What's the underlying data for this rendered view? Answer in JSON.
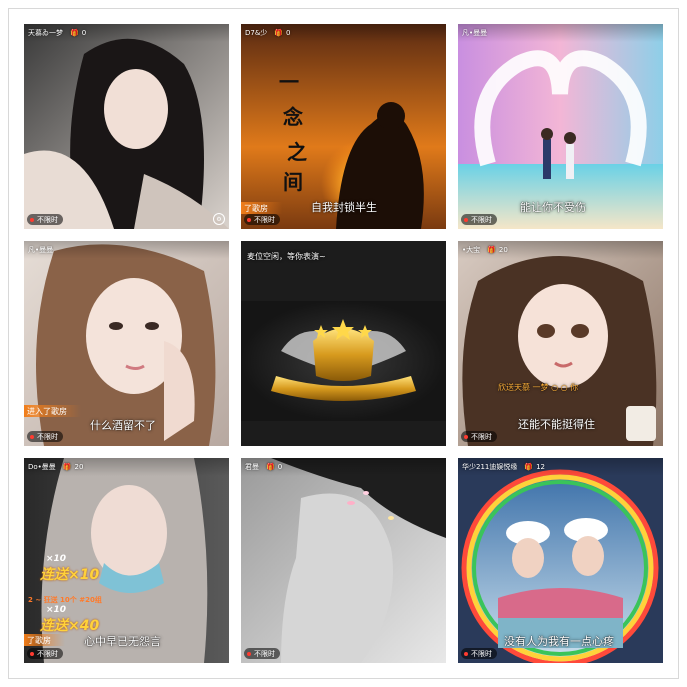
{
  "cards": [
    {
      "user": "天慕ゐ一梦",
      "count": "0",
      "tag": "不限时"
    },
    {
      "user": "D7&少",
      "count": "0",
      "tag": "不限时",
      "banner": "了歌房",
      "caption": "自我封锁半生",
      "poster_text": "一念之间"
    },
    {
      "user": "凡•曼曼",
      "count": "",
      "tag": "不限时",
      "caption": "能让你不受伤"
    },
    {
      "user": "凡•曼曼",
      "count": "",
      "tag": "不限时",
      "banner": "进入了歌房",
      "caption": "什么酒留不了"
    },
    {
      "user": "",
      "count": "",
      "tag": "",
      "notice": "麦位空闲，等你表演~"
    },
    {
      "user": "•大宝",
      "count": "20",
      "tag": "不限时",
      "gift_line": "欣送天慕 一梦 ○ ○ 你",
      "caption": "还能不能挺得住"
    },
    {
      "user": "Do•曼曼",
      "count": "20",
      "tag": "不限时",
      "banner": "了歌房",
      "caption": "心中早已无怨言",
      "gift1_mult": "×10",
      "gift1_text": "连送×10",
      "gift2_mult": "×10",
      "gift2_text": "连送×40",
      "gift_row": "2 ~ 狂送  10个  #20组"
    },
    {
      "user": "君曼",
      "count": "0",
      "tag": "不限时"
    },
    {
      "user": "华少211迪娱悦缘",
      "count": "12",
      "tag": "不限时",
      "caption": "没有人为我有一点心疼"
    }
  ],
  "colors": {
    "accent": "#f07d1a",
    "live_dot": "#ff3b30"
  },
  "icons": {
    "gift": "gift-icon",
    "settings": "settings-icon"
  }
}
